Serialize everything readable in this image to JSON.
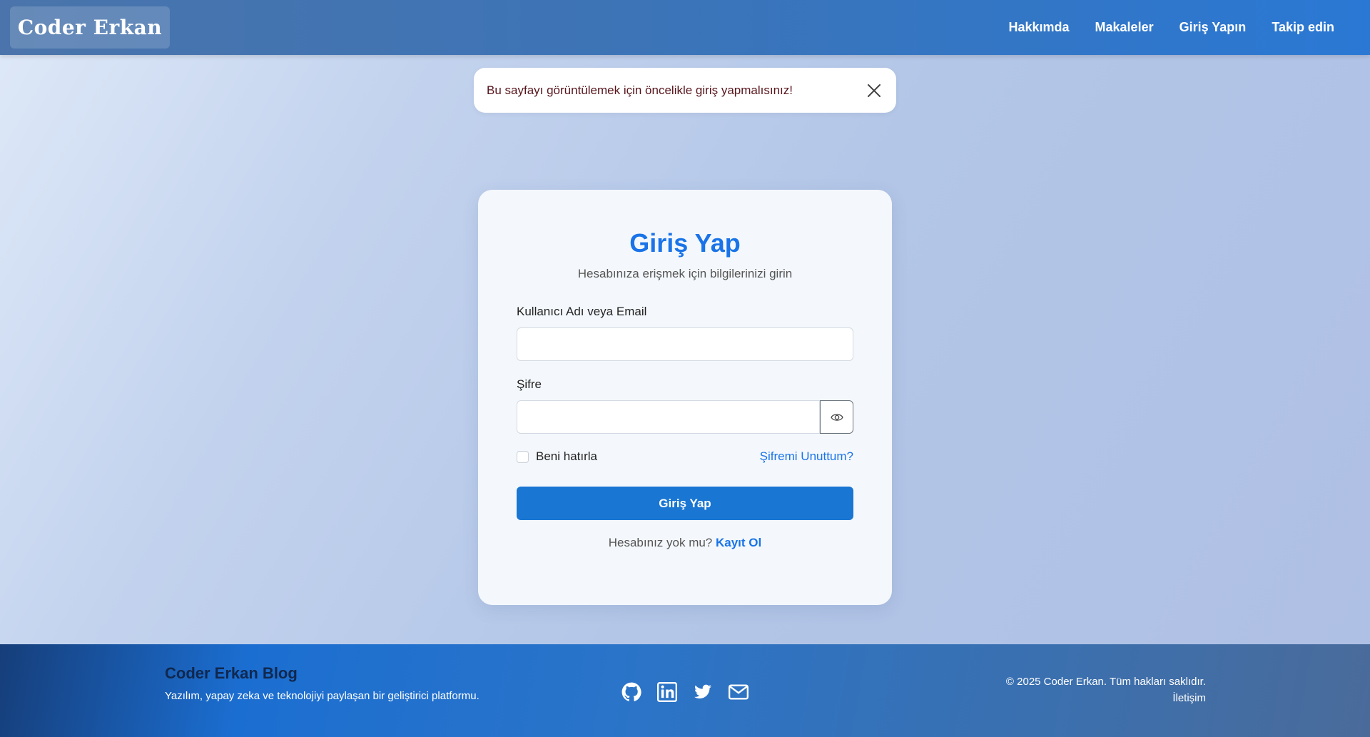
{
  "header": {
    "brand": "Coder Erkan",
    "nav": [
      "Hakkımda",
      "Makaleler",
      "Giriş Yapın",
      "Takip edin"
    ]
  },
  "alert": {
    "message": "Bu sayfayı görüntülemek için öncelikle giriş yapmalısınız!",
    "close_icon": "close-icon"
  },
  "login": {
    "title": "Giriş Yap",
    "subtitle": "Hesabınıza erişmek için bilgilerinizi girin",
    "username_label": "Kullanıcı Adı veya Email",
    "username_value": "",
    "password_label": "Şifre",
    "password_value": "",
    "toggle_password_icon": "eye-icon",
    "remember_label": "Beni hatırla",
    "remember_checked": false,
    "forgot_link": "Şifremi Unuttum?",
    "submit_label": "Giriş Yap",
    "no_account_text": "Hesabınız yok mu?",
    "register_link": "Kayıt Ol"
  },
  "footer": {
    "title": "Coder Erkan Blog",
    "description": "Yazılım, yapay zeka ve teknolojiyi paylaşan bir geliştirici platformu.",
    "socials": [
      "github-icon",
      "linkedin-icon",
      "twitter-icon",
      "mail-icon"
    ],
    "copyright": "© 2025 Coder Erkan. Tüm hakları saklıdır.",
    "contact_link": "İletişim"
  },
  "colors": {
    "primary": "#1a73e8",
    "button": "#1976d2",
    "alert_text": "#58151c"
  }
}
